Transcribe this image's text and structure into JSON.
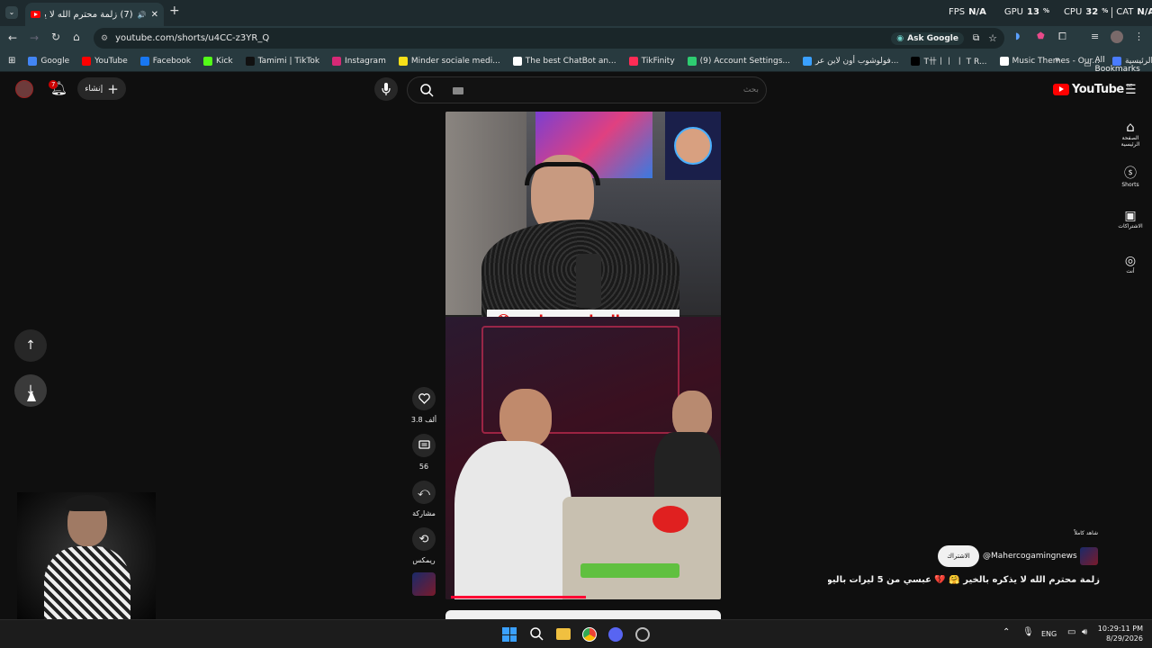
{
  "browser": {
    "tab_title": "(7) زلمة محترم الله لا يذكره بال",
    "url": "youtube.com/shorts/u4CC-z3YR_Q",
    "ask_google": "Ask Google",
    "bookmarks": [
      {
        "label": "Google",
        "color": "#4285f4"
      },
      {
        "label": "YouTube",
        "color": "#ff0000"
      },
      {
        "label": "Facebook",
        "color": "#1877f2"
      },
      {
        "label": "Kick",
        "color": "#53fc18"
      },
      {
        "label": "Tamimi | TikTok",
        "color": "#111111"
      },
      {
        "label": "Instagram",
        "color": "#d62976"
      },
      {
        "label": "Minder sociale medi...",
        "color": "#f7e018"
      },
      {
        "label": "The best ChatBot an...",
        "color": "#ffffff"
      },
      {
        "label": "TikFinity",
        "color": "#fe2c55"
      },
      {
        "label": "(9) Account Settings...",
        "color": "#2ecc71"
      },
      {
        "label": "فولوشوب أون لاين عر...",
        "color": "#3aa0ff"
      },
      {
        "label": "T卄丨丨 丨 T R...",
        "color": "#000000"
      },
      {
        "label": "Music Themes - Our...",
        "color": "#ffffff"
      },
      {
        "label": "دعم الأعمال الرئيسية",
        "color": "#4a7cff"
      }
    ],
    "all_bookmarks": "All Bookmarks"
  },
  "overlay": {
    "fps_label": "FPS",
    "fps_value": "N/A",
    "gpu_label": "GPU",
    "gpu_value": "13",
    "cpu_label": "CPU",
    "cpu_value": "32",
    "cat_label": "CAT",
    "cat_value": "N/A"
  },
  "youtube": {
    "logo_text": "YouTube",
    "region": "BE",
    "search_placeholder": "بحث",
    "create_label": "إنشاء",
    "notification_count": "7",
    "sidebar": [
      {
        "label": "الصفحة الرئيسية"
      },
      {
        "label": "Shorts"
      },
      {
        "label": "الاشتراكات"
      },
      {
        "label": "أنت"
      }
    ],
    "actions": {
      "likes": "3.8 ألف",
      "comments": "56",
      "share": "مشاركة",
      "remix": "ريمكس"
    },
    "video_caption": "بشتري المطعم وصاحبه 😳",
    "channel": {
      "linked_label": "شاهد كاملاً",
      "handle": "@Mahercogamingnews",
      "subscribe": "الاشتراك",
      "title": "زلمة محترم الله لا يذكره بالخير 🤗 💔 عبسي من 5 ليرات باليوم ..."
    }
  },
  "taskbar": {
    "language": "ENG",
    "time": "10:29:11 PM",
    "date": "8/29/2026"
  }
}
